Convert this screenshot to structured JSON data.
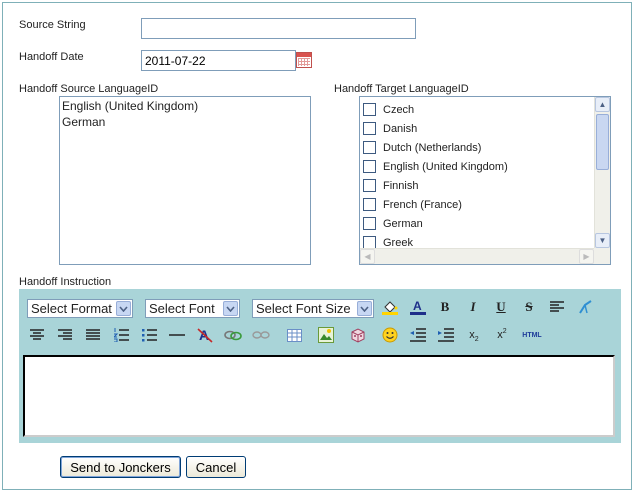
{
  "form": {
    "source_string_label": "Source String",
    "source_string_value": "",
    "handoff_date_label": "Handoff Date",
    "handoff_date_value": "2011-07-22",
    "source_language_label": "Handoff Source LanguageID",
    "source_languages": [
      "English (United Kingdom)",
      "German"
    ],
    "target_language_label": "Handoff Target LanguageID",
    "target_languages": [
      "Czech",
      "Danish",
      "Dutch (Netherlands)",
      "English (United Kingdom)",
      "Finnish",
      "French (France)",
      "German",
      "Greek"
    ],
    "instruction_label": "Handoff Instruction"
  },
  "editor": {
    "format_select": "Select Format",
    "font_select": "Select Font",
    "size_select": "Select Font Size",
    "toolbar_row1": [
      "fill-color-icon",
      "font-color-icon",
      "bold-icon",
      "italic-icon",
      "underline-icon",
      "strikethrough-icon",
      "align-left-icon",
      "clean-format-icon"
    ],
    "toolbar_row2": [
      "align-center-icon",
      "align-right-icon",
      "justify-icon",
      "ordered-list-icon",
      "unordered-list-icon",
      "horizontal-rule-icon",
      "remove-format-icon",
      "link-icon",
      "unlink-icon",
      "table-icon",
      "image-icon",
      "special-char-icon",
      "smiley-icon",
      "outdent-icon",
      "indent-icon",
      "subscript-icon",
      "superscript-icon",
      "html-icon"
    ],
    "bold_glyph": "B",
    "italic_glyph": "I",
    "underline_glyph": "U",
    "strike_glyph": "S",
    "html_glyph": "HTML",
    "sub_glyph": "x",
    "sub_num": "2",
    "sup_glyph": "x",
    "sup_num": "2",
    "font_color_glyph": "A"
  },
  "actions": {
    "send_label": "Send to Jonckers",
    "cancel_label": "Cancel"
  }
}
